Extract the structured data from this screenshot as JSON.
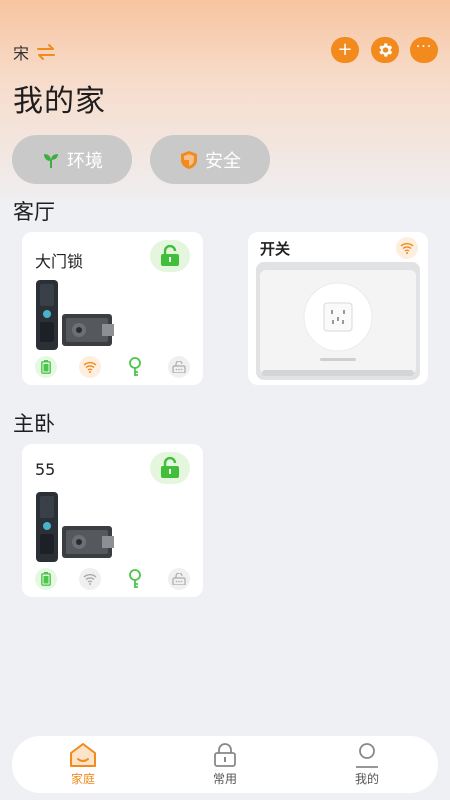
{
  "header": {
    "home_name": "宋",
    "title": "我的家"
  },
  "quick": {
    "environment": "环境",
    "security": "安全"
  },
  "rooms": [
    {
      "name": "客厅",
      "devices": [
        {
          "name": "大门锁"
        },
        {
          "name": "开关"
        }
      ]
    },
    {
      "name": "主卧",
      "devices": [
        {
          "name": "55"
        }
      ]
    }
  ],
  "tabs": [
    {
      "label": "家庭"
    },
    {
      "label": "常用"
    },
    {
      "label": "我的"
    }
  ],
  "colors": {
    "accent": "#f28a1d",
    "lock_green": "#3fbf3a",
    "battery_green": "#4cc64a"
  }
}
